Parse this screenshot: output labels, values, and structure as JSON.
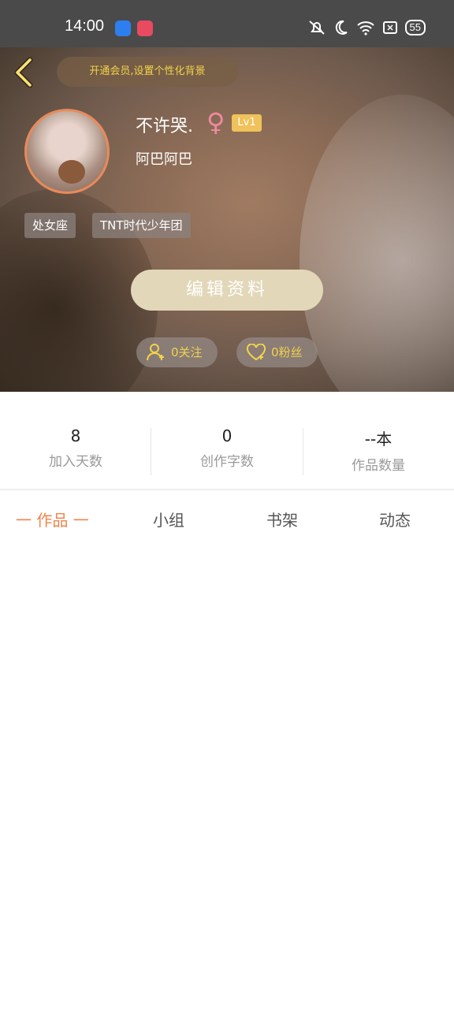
{
  "status_bar": {
    "time": "14:00",
    "battery": "55"
  },
  "header": {
    "vip_banner": "开通会员,设置个性化背景"
  },
  "profile": {
    "nickname": "不许哭.",
    "gender_symbol": "♀",
    "level": "Lv1",
    "signature": "阿巴阿巴",
    "tags": [
      "处女座",
      "TNT时代少年团"
    ],
    "edit_button": "编辑资料",
    "following": "0关注",
    "followers": "0粉丝"
  },
  "stats": [
    {
      "value": "8",
      "label": "加入天数"
    },
    {
      "value": "0",
      "label": "创作字数"
    },
    {
      "value": "--本",
      "label": "作品数量"
    }
  ],
  "tabs": [
    {
      "label": "一 作品 一",
      "active": true
    },
    {
      "label": "小组",
      "active": false
    },
    {
      "label": "书架",
      "active": false
    },
    {
      "label": "动态",
      "active": false
    }
  ],
  "colors": {
    "accent": "#f0854c",
    "gold": "#f2d34a",
    "button": "#e2d7b8"
  }
}
